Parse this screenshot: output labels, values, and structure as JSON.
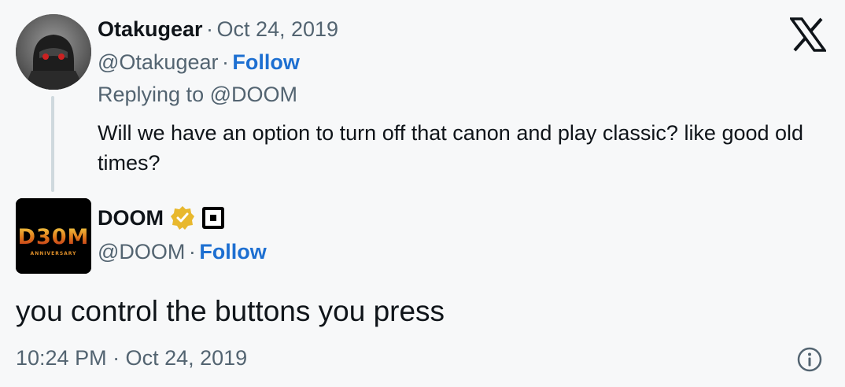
{
  "parent": {
    "name": "Otakugear",
    "date": "Oct 24, 2019",
    "handle": "@Otakugear",
    "follow_label": "Follow",
    "replying_to": "Replying to @DOOM",
    "text": "Will we have an option to turn off that canon and play classic? like good old times?"
  },
  "reply": {
    "name": "DOOM",
    "handle": "@DOOM",
    "follow_label": "Follow",
    "text": "you control the buttons you press",
    "timestamp": "10:24 PM · Oct 24, 2019",
    "avatar_text": "D30M",
    "avatar_subtext": "ANNIVERSARY"
  },
  "separator": "·",
  "colors": {
    "follow": "#1d6fd1",
    "verified_badge": "#e8b82e",
    "muted": "#536471"
  },
  "icons": {
    "brand": "x-logo-icon",
    "verified": "verified-badge-icon",
    "affiliate": "affiliate-square-icon",
    "info": "info-icon"
  }
}
